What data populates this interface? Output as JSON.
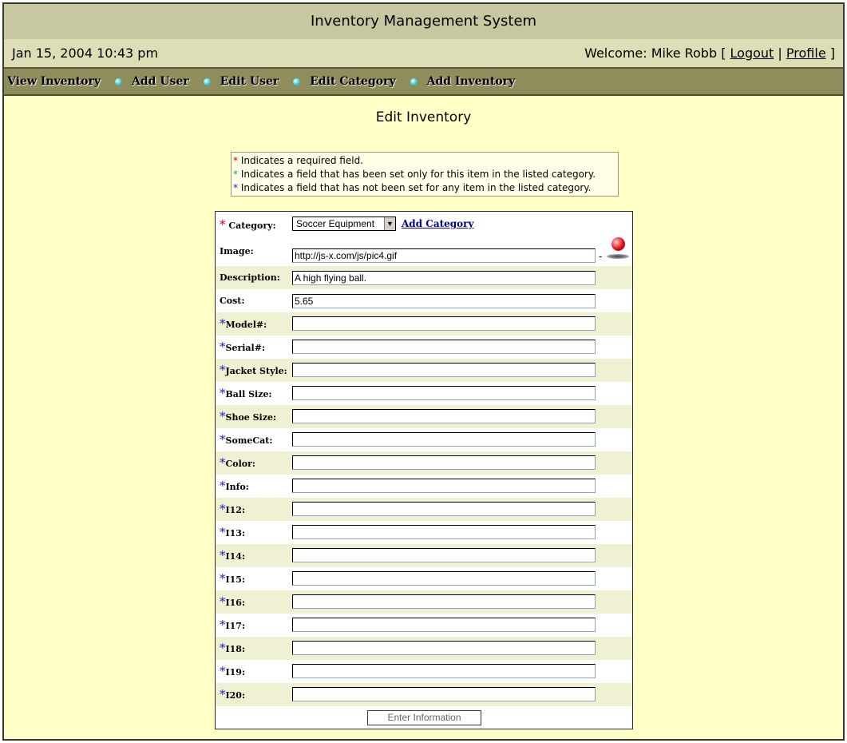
{
  "header": {
    "title": "Inventory Management System",
    "datetime": "Jan 15, 2004 10:43 pm",
    "welcome_prefix": "Welcome: Mike Robb [",
    "logout_label": "Logout",
    "separator": "|",
    "profile_label": "Profile",
    "suffix": "]"
  },
  "nav": {
    "items": [
      {
        "label": "View Inventory"
      },
      {
        "label": "Add User"
      },
      {
        "label": "Edit User"
      },
      {
        "label": "Edit Category"
      },
      {
        "label": "Add Inventory"
      }
    ]
  },
  "page": {
    "title": "Edit Inventory"
  },
  "legend": {
    "required": "Indicates a required field.",
    "set_only_this": "Indicates a field that has been set only for this item in the listed category.",
    "not_set_any": "Indicates a field that has not been set for any item in the listed category."
  },
  "form": {
    "category": {
      "label": "Category:",
      "selected": "Soccer Equipment",
      "add_link": "Add Category"
    },
    "image": {
      "label": "Image:",
      "value": "http://js-x.com/js/pic4.gif"
    },
    "description": {
      "label": "Description:",
      "value": "A high flying ball."
    },
    "cost": {
      "label": "Cost:",
      "value": "5.65"
    },
    "fields": [
      {
        "label": "Model#:",
        "value": ""
      },
      {
        "label": "Serial#:",
        "value": ""
      },
      {
        "label": "Jacket Style:",
        "value": ""
      },
      {
        "label": "Ball Size:",
        "value": ""
      },
      {
        "label": "Shoe Size:",
        "value": ""
      },
      {
        "label": "SomeCat:",
        "value": ""
      },
      {
        "label": "Color:",
        "value": ""
      },
      {
        "label": "Info:",
        "value": ""
      },
      {
        "label": "I12:",
        "value": ""
      },
      {
        "label": "I13:",
        "value": ""
      },
      {
        "label": "I14:",
        "value": ""
      },
      {
        "label": "I15:",
        "value": ""
      },
      {
        "label": "I16:",
        "value": ""
      },
      {
        "label": "I17:",
        "value": ""
      },
      {
        "label": "I18:",
        "value": ""
      },
      {
        "label": "I19:",
        "value": ""
      },
      {
        "label": "I20:",
        "value": ""
      }
    ],
    "submit_label": "Enter Information"
  },
  "icons": {
    "image_preview": "red-ball-icon",
    "nav_bullet": "cyan-bullet-icon"
  },
  "colors": {
    "title_bar": "#c8c8a0",
    "info_bar": "#dedeb6",
    "nav_bar": "#8f8d5b",
    "content_bg": "#ffffc6",
    "row_alt": "#f0f0d2",
    "required_star": "#d8000c",
    "set_star": "#2f9a4a",
    "unset_star": "#2020c8"
  }
}
